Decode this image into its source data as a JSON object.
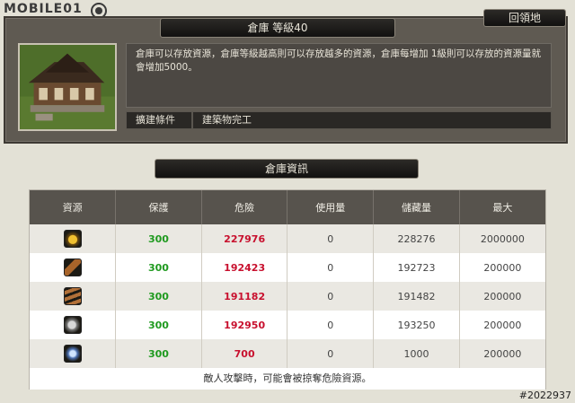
{
  "watermark": {
    "text": "MOBILE01"
  },
  "footer_id": "#2022937",
  "building": {
    "title": "倉庫 等級40",
    "back_label": "回領地",
    "description": "倉庫可以存放資源，倉庫等級越高則可以存放越多的資源，倉庫每增加 1級則可以存放的資源量就會增加5000。",
    "requirement_label": "擴建條件",
    "requirement_value": "建築物完工"
  },
  "storage": {
    "section_title": "倉庫資訊",
    "columns": [
      "資源",
      "保護",
      "危險",
      "使用量",
      "儲藏量",
      "最大"
    ],
    "rows": [
      {
        "icon": "gold-icon",
        "protect": "300",
        "danger": "227976",
        "used": "0",
        "stored": "228276",
        "max": "2000000"
      },
      {
        "icon": "wood-icon",
        "protect": "300",
        "danger": "192423",
        "used": "0",
        "stored": "192723",
        "max": "200000"
      },
      {
        "icon": "logs-icon",
        "protect": "300",
        "danger": "191182",
        "used": "0",
        "stored": "191482",
        "max": "200000"
      },
      {
        "icon": "stone-icon",
        "protect": "300",
        "danger": "192950",
        "used": "0",
        "stored": "193250",
        "max": "200000"
      },
      {
        "icon": "crystal-icon",
        "protect": "300",
        "danger": "700",
        "used": "0",
        "stored": "1000",
        "max": "200000"
      }
    ],
    "note": "敵人攻擊時，可能會被掠奪危險資源。"
  },
  "colors": {
    "protect": "#1f9a1f",
    "danger": "#c8102e",
    "panel": "#5f5a52"
  }
}
